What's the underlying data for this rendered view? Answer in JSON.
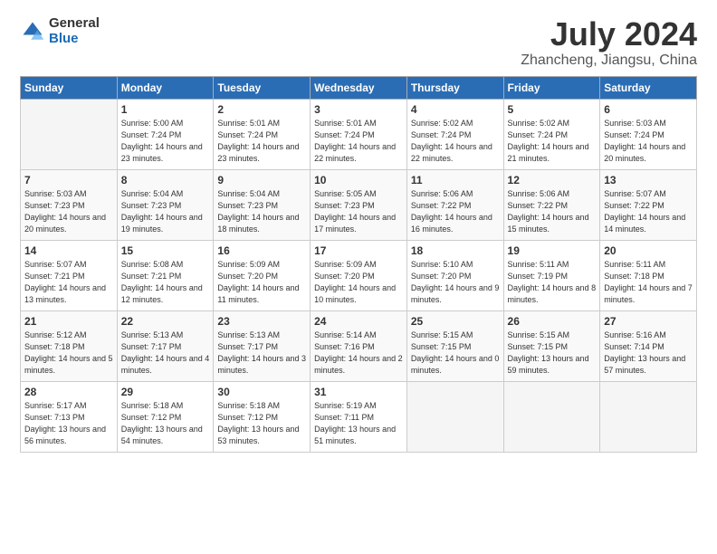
{
  "logo": {
    "general": "General",
    "blue": "Blue"
  },
  "title": "July 2024",
  "subtitle": "Zhancheng, Jiangsu, China",
  "days_of_week": [
    "Sunday",
    "Monday",
    "Tuesday",
    "Wednesday",
    "Thursday",
    "Friday",
    "Saturday"
  ],
  "weeks": [
    [
      {
        "num": "",
        "sunrise": "",
        "sunset": "",
        "daylight": "",
        "empty": true
      },
      {
        "num": "1",
        "sunrise": "5:00 AM",
        "sunset": "7:24 PM",
        "daylight": "14 hours and 23 minutes."
      },
      {
        "num": "2",
        "sunrise": "5:01 AM",
        "sunset": "7:24 PM",
        "daylight": "14 hours and 23 minutes."
      },
      {
        "num": "3",
        "sunrise": "5:01 AM",
        "sunset": "7:24 PM",
        "daylight": "14 hours and 22 minutes."
      },
      {
        "num": "4",
        "sunrise": "5:02 AM",
        "sunset": "7:24 PM",
        "daylight": "14 hours and 22 minutes."
      },
      {
        "num": "5",
        "sunrise": "5:02 AM",
        "sunset": "7:24 PM",
        "daylight": "14 hours and 21 minutes."
      },
      {
        "num": "6",
        "sunrise": "5:03 AM",
        "sunset": "7:24 PM",
        "daylight": "14 hours and 20 minutes."
      }
    ],
    [
      {
        "num": "7",
        "sunrise": "5:03 AM",
        "sunset": "7:23 PM",
        "daylight": "14 hours and 20 minutes."
      },
      {
        "num": "8",
        "sunrise": "5:04 AM",
        "sunset": "7:23 PM",
        "daylight": "14 hours and 19 minutes."
      },
      {
        "num": "9",
        "sunrise": "5:04 AM",
        "sunset": "7:23 PM",
        "daylight": "14 hours and 18 minutes."
      },
      {
        "num": "10",
        "sunrise": "5:05 AM",
        "sunset": "7:23 PM",
        "daylight": "14 hours and 17 minutes."
      },
      {
        "num": "11",
        "sunrise": "5:06 AM",
        "sunset": "7:22 PM",
        "daylight": "14 hours and 16 minutes."
      },
      {
        "num": "12",
        "sunrise": "5:06 AM",
        "sunset": "7:22 PM",
        "daylight": "14 hours and 15 minutes."
      },
      {
        "num": "13",
        "sunrise": "5:07 AM",
        "sunset": "7:22 PM",
        "daylight": "14 hours and 14 minutes."
      }
    ],
    [
      {
        "num": "14",
        "sunrise": "5:07 AM",
        "sunset": "7:21 PM",
        "daylight": "14 hours and 13 minutes."
      },
      {
        "num": "15",
        "sunrise": "5:08 AM",
        "sunset": "7:21 PM",
        "daylight": "14 hours and 12 minutes."
      },
      {
        "num": "16",
        "sunrise": "5:09 AM",
        "sunset": "7:20 PM",
        "daylight": "14 hours and 11 minutes."
      },
      {
        "num": "17",
        "sunrise": "5:09 AM",
        "sunset": "7:20 PM",
        "daylight": "14 hours and 10 minutes."
      },
      {
        "num": "18",
        "sunrise": "5:10 AM",
        "sunset": "7:20 PM",
        "daylight": "14 hours and 9 minutes."
      },
      {
        "num": "19",
        "sunrise": "5:11 AM",
        "sunset": "7:19 PM",
        "daylight": "14 hours and 8 minutes."
      },
      {
        "num": "20",
        "sunrise": "5:11 AM",
        "sunset": "7:18 PM",
        "daylight": "14 hours and 7 minutes."
      }
    ],
    [
      {
        "num": "21",
        "sunrise": "5:12 AM",
        "sunset": "7:18 PM",
        "daylight": "14 hours and 5 minutes."
      },
      {
        "num": "22",
        "sunrise": "5:13 AM",
        "sunset": "7:17 PM",
        "daylight": "14 hours and 4 minutes."
      },
      {
        "num": "23",
        "sunrise": "5:13 AM",
        "sunset": "7:17 PM",
        "daylight": "14 hours and 3 minutes."
      },
      {
        "num": "24",
        "sunrise": "5:14 AM",
        "sunset": "7:16 PM",
        "daylight": "14 hours and 2 minutes."
      },
      {
        "num": "25",
        "sunrise": "5:15 AM",
        "sunset": "7:15 PM",
        "daylight": "14 hours and 0 minutes."
      },
      {
        "num": "26",
        "sunrise": "5:15 AM",
        "sunset": "7:15 PM",
        "daylight": "13 hours and 59 minutes."
      },
      {
        "num": "27",
        "sunrise": "5:16 AM",
        "sunset": "7:14 PM",
        "daylight": "13 hours and 57 minutes."
      }
    ],
    [
      {
        "num": "28",
        "sunrise": "5:17 AM",
        "sunset": "7:13 PM",
        "daylight": "13 hours and 56 minutes."
      },
      {
        "num": "29",
        "sunrise": "5:18 AM",
        "sunset": "7:12 PM",
        "daylight": "13 hours and 54 minutes."
      },
      {
        "num": "30",
        "sunrise": "5:18 AM",
        "sunset": "7:12 PM",
        "daylight": "13 hours and 53 minutes."
      },
      {
        "num": "31",
        "sunrise": "5:19 AM",
        "sunset": "7:11 PM",
        "daylight": "13 hours and 51 minutes."
      },
      {
        "num": "",
        "sunrise": "",
        "sunset": "",
        "daylight": "",
        "empty": true
      },
      {
        "num": "",
        "sunrise": "",
        "sunset": "",
        "daylight": "",
        "empty": true
      },
      {
        "num": "",
        "sunrise": "",
        "sunset": "",
        "daylight": "",
        "empty": true
      }
    ]
  ],
  "labels": {
    "sunrise_prefix": "Sunrise: ",
    "sunset_prefix": "Sunset: ",
    "daylight_prefix": "Daylight: "
  }
}
